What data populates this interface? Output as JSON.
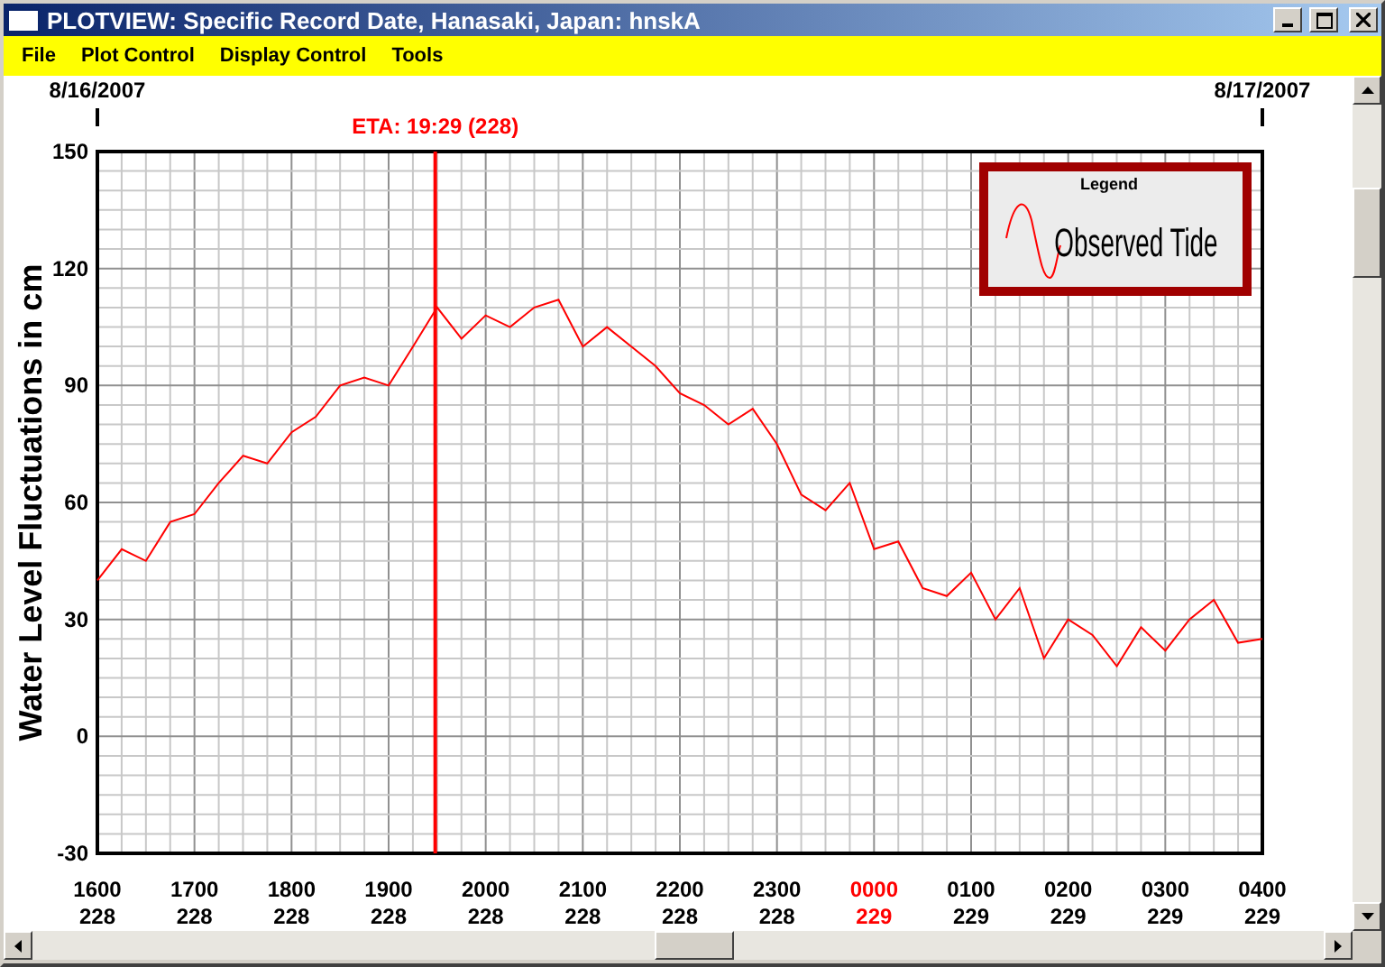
{
  "window": {
    "title": "PLOTVIEW: Specific Record Date, Hanasaki, Japan: hnskA"
  },
  "menu": [
    {
      "label": "File"
    },
    {
      "label": "Plot Control"
    },
    {
      "label": "Display Control"
    },
    {
      "label": "Tools"
    }
  ],
  "eta_marker": {
    "label": "ETA: 19:29 (228)",
    "level": 0.29
  },
  "date_markers": [
    {
      "label": "8/16/2007"
    },
    {
      "label": "8/17/2007"
    }
  ],
  "day_labels": [
    {
      "day": "228",
      "highlight": false
    },
    {
      "day": "228",
      "highlight": false
    },
    {
      "day": "228",
      "highlight": false
    },
    {
      "day": "228",
      "highlight": false
    },
    {
      "day": "228",
      "highlight": false
    },
    {
      "day": "228",
      "highlight": false
    },
    {
      "day": "228",
      "highlight": false
    },
    {
      "day": "228",
      "highlight": false
    },
    {
      "day": "229",
      "highlight": true
    },
    {
      "day": "229",
      "highlight": false
    },
    {
      "day": "229",
      "highlight": false
    },
    {
      "day": "229",
      "highlight": false
    },
    {
      "day": "229",
      "highlight": false
    }
  ],
  "chart_data": {
    "type": "line",
    "ylabel": "Water Level Fluctuations in cm",
    "ylim": [
      -30,
      150
    ],
    "yticks": [
      -30,
      0,
      30,
      60,
      90,
      120,
      150
    ],
    "categories": [
      "1600",
      null,
      null,
      null,
      "1700",
      null,
      null,
      null,
      "1800",
      null,
      null,
      null,
      "1900",
      null,
      null,
      null,
      "2000",
      null,
      null,
      null,
      "2100",
      null,
      null,
      null,
      "2200",
      null,
      null,
      null,
      "2300",
      null,
      null,
      null,
      "0000",
      null,
      null,
      null,
      "0100",
      null,
      null,
      null,
      "0200",
      null,
      null,
      null,
      "0300",
      null,
      null,
      null,
      "0400"
    ],
    "series": [
      {
        "name": "Observed Tide",
        "color": "#ff0000",
        "values": [
          40,
          48,
          45,
          55,
          57,
          65,
          72,
          70,
          78,
          82,
          90,
          92,
          90,
          100,
          110,
          102,
          108,
          105,
          110,
          112,
          100,
          105,
          100,
          95,
          88,
          85,
          80,
          84,
          75,
          62,
          58,
          65,
          48,
          50,
          38,
          36,
          42,
          30,
          38,
          20,
          30,
          26,
          18,
          28,
          22,
          30,
          35,
          24,
          25
        ]
      }
    ],
    "grid": true,
    "legend": {
      "title": "Legend"
    }
  }
}
